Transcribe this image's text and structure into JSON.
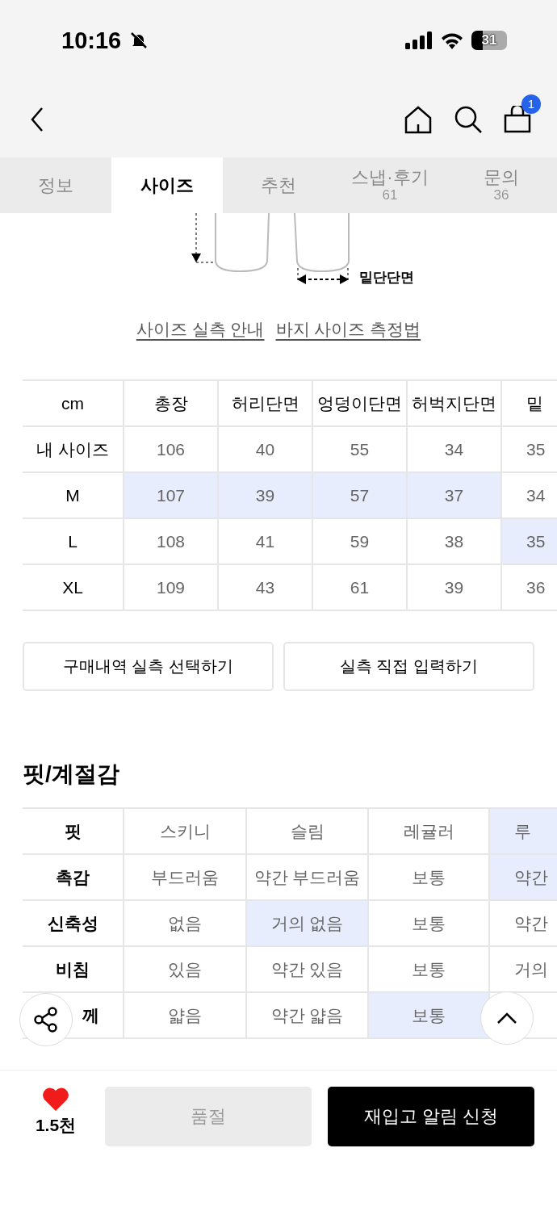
{
  "status_bar": {
    "time": "10:16",
    "battery": "31"
  },
  "nav": {
    "cart_count": "1"
  },
  "tabs": [
    {
      "label": "정보",
      "selected": false
    },
    {
      "label": "사이즈",
      "selected": true
    },
    {
      "label": "추천",
      "selected": false
    },
    {
      "label": "스냅·후기",
      "count": "61",
      "selected": false
    },
    {
      "label": "문의",
      "count": "36",
      "selected": false
    }
  ],
  "diagram": {
    "label": "밑단단면"
  },
  "links": [
    "사이즈 실측 안내",
    "바지 사이즈 측정법"
  ],
  "size_table": {
    "corner": "cm",
    "columns": [
      "총장",
      "허리단면",
      "엉덩이단면",
      "허벅지단면",
      "밑"
    ],
    "rows": [
      {
        "label": "내 사이즈",
        "cells": [
          {
            "value": "106",
            "selected": false
          },
          {
            "value": "40",
            "selected": false
          },
          {
            "value": "55",
            "selected": false
          },
          {
            "value": "34",
            "selected": false
          },
          {
            "value": "35",
            "selected": false
          }
        ]
      },
      {
        "label": "M",
        "cells": [
          {
            "value": "107",
            "selected": true
          },
          {
            "value": "39",
            "selected": true
          },
          {
            "value": "57",
            "selected": true
          },
          {
            "value": "37",
            "selected": true
          },
          {
            "value": "34",
            "selected": false
          }
        ]
      },
      {
        "label": "L",
        "cells": [
          {
            "value": "108",
            "selected": false
          },
          {
            "value": "41",
            "selected": false
          },
          {
            "value": "59",
            "selected": false
          },
          {
            "value": "38",
            "selected": false
          },
          {
            "value": "35",
            "selected": true
          }
        ]
      },
      {
        "label": "XL",
        "cells": [
          {
            "value": "109",
            "selected": false
          },
          {
            "value": "43",
            "selected": false
          },
          {
            "value": "61",
            "selected": false
          },
          {
            "value": "39",
            "selected": false
          },
          {
            "value": "36",
            "selected": false
          }
        ]
      }
    ]
  },
  "action_buttons": [
    "구매내역 실측 선택하기",
    "실측 직접 입력하기"
  ],
  "fit_section": {
    "title": "핏/계절감",
    "rows": [
      {
        "label": "핏",
        "covered": false,
        "cells": [
          {
            "value": "스키니",
            "selected": false
          },
          {
            "value": "슬림",
            "selected": false
          },
          {
            "value": "레귤러",
            "selected": false
          },
          {
            "value": "루",
            "selected": true
          }
        ]
      },
      {
        "label": "촉감",
        "covered": false,
        "cells": [
          {
            "value": "부드러움",
            "selected": false
          },
          {
            "value": "약간 부드러움",
            "selected": false
          },
          {
            "value": "보통",
            "selected": false
          },
          {
            "value": "약간",
            "selected": true
          }
        ]
      },
      {
        "label": "신축성",
        "covered": false,
        "cells": [
          {
            "value": "없음",
            "selected": false
          },
          {
            "value": "거의 없음",
            "selected": true
          },
          {
            "value": "보통",
            "selected": false
          },
          {
            "value": "약간",
            "selected": false
          }
        ]
      },
      {
        "label": "비침",
        "covered": false,
        "cells": [
          {
            "value": "있음",
            "selected": false
          },
          {
            "value": "약간 있음",
            "selected": false
          },
          {
            "value": "보통",
            "selected": false
          },
          {
            "value": "거의",
            "selected": false
          }
        ]
      },
      {
        "label": "께",
        "covered": true,
        "cells": [
          {
            "value": "얇음",
            "selected": false
          },
          {
            "value": "약간 얇음",
            "selected": false
          },
          {
            "value": "보통",
            "selected": true
          },
          {
            "selected": false
          }
        ]
      }
    ]
  },
  "bottom_bar": {
    "likes": "1.5천",
    "sold_out": {
      "label": "품절",
      "disabled": true
    },
    "notify": "재입고 알림 신청"
  }
}
